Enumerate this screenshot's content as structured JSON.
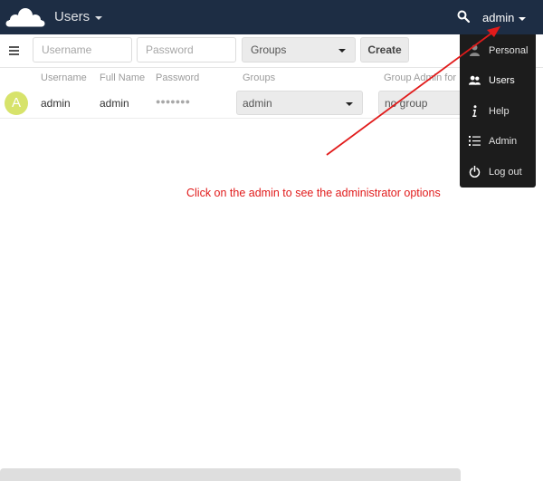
{
  "header": {
    "app_title": "Users",
    "user_label": "admin"
  },
  "controls": {
    "username_placeholder": "Username",
    "password_placeholder": "Password",
    "groups_select": "Groups",
    "create_label": "Create"
  },
  "table": {
    "columns": [
      "Username",
      "Full Name",
      "Password",
      "Groups",
      "Group Admin for"
    ],
    "rows": [
      {
        "avatar_letter": "A",
        "username": "admin",
        "full_name": "admin",
        "password": "●●●●●●●",
        "groups": "admin",
        "group_admin": "no group"
      }
    ]
  },
  "user_menu": {
    "items": [
      {
        "label": "Personal",
        "icon": "person-icon"
      },
      {
        "label": "Users",
        "icon": "users-icon"
      },
      {
        "label": "Help",
        "icon": "info-icon"
      },
      {
        "label": "Admin",
        "icon": "list-icon"
      },
      {
        "label": "Log out",
        "icon": "power-icon"
      }
    ]
  },
  "annotation": {
    "text": "Click on the admin to see the administrator options",
    "color": "#e11b1b"
  },
  "colors": {
    "header_bg": "#1d2d44",
    "menu_bg": "#1c1c1c",
    "avatar_bg": "#d7e36b"
  }
}
